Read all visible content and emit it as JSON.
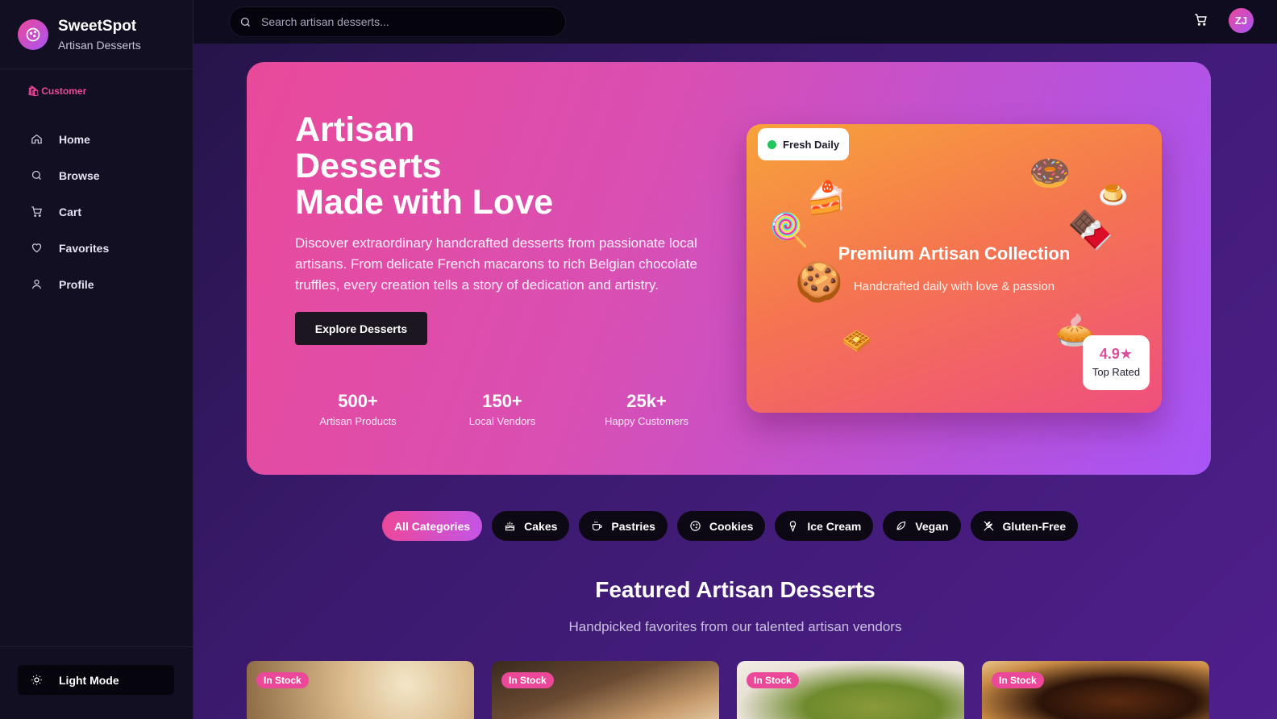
{
  "brand": {
    "name": "SweetSpot",
    "subtitle": "Artisan Desserts"
  },
  "role": {
    "label": "Customer",
    "icon": "shopping-bag-icon"
  },
  "nav": [
    {
      "label": "Home",
      "icon": "home-icon"
    },
    {
      "label": "Browse",
      "icon": "search-icon"
    },
    {
      "label": "Cart",
      "icon": "cart-icon"
    },
    {
      "label": "Favorites",
      "icon": "heart-icon"
    },
    {
      "label": "Profile",
      "icon": "user-icon"
    }
  ],
  "theme_toggle": {
    "label": "Light Mode",
    "icon": "sun-icon"
  },
  "search": {
    "placeholder": "Search artisan desserts..."
  },
  "user": {
    "initials": "ZJ"
  },
  "hero": {
    "title_line1": "Artisan",
    "title_line2": "Desserts",
    "title_line3": "Made with Love",
    "description": "Discover extraordinary handcrafted desserts from passionate local artisans. From delicate French macarons to rich Belgian chocolate truffles, every creation tells a story of dedication and artistry.",
    "cta": "Explore Desserts",
    "stats": [
      {
        "value": "500+",
        "label": "Artisan Products"
      },
      {
        "value": "150+",
        "label": "Local Vendors"
      },
      {
        "value": "25k+",
        "label": "Happy Customers"
      }
    ]
  },
  "promo": {
    "badge": "Fresh Daily",
    "title": "Premium Artisan Collection",
    "subtitle": "Handcrafted daily with love & passion",
    "rating_value": "4.9★",
    "rating_label": "Top Rated"
  },
  "categories": [
    {
      "label": "All Categories",
      "icon": "",
      "active": true
    },
    {
      "label": "Cakes",
      "icon": "cake-icon"
    },
    {
      "label": "Pastries",
      "icon": "coffee-icon"
    },
    {
      "label": "Cookies",
      "icon": "cookie-icon"
    },
    {
      "label": "Ice Cream",
      "icon": "ice-cream-icon"
    },
    {
      "label": "Vegan",
      "icon": "leaf-icon"
    },
    {
      "label": "Gluten-Free",
      "icon": "wheat-icon"
    }
  ],
  "featured": {
    "title": "Featured Artisan Desserts",
    "subtitle": "Handpicked favorites from our talented artisan vendors",
    "products": [
      {
        "badge": "In Stock"
      },
      {
        "badge": "In Stock"
      },
      {
        "badge": "In Stock"
      },
      {
        "badge": "In Stock"
      }
    ]
  },
  "colors": {
    "accent": "#ec4899",
    "accent2": "#a855f7",
    "success": "#22c55e"
  }
}
